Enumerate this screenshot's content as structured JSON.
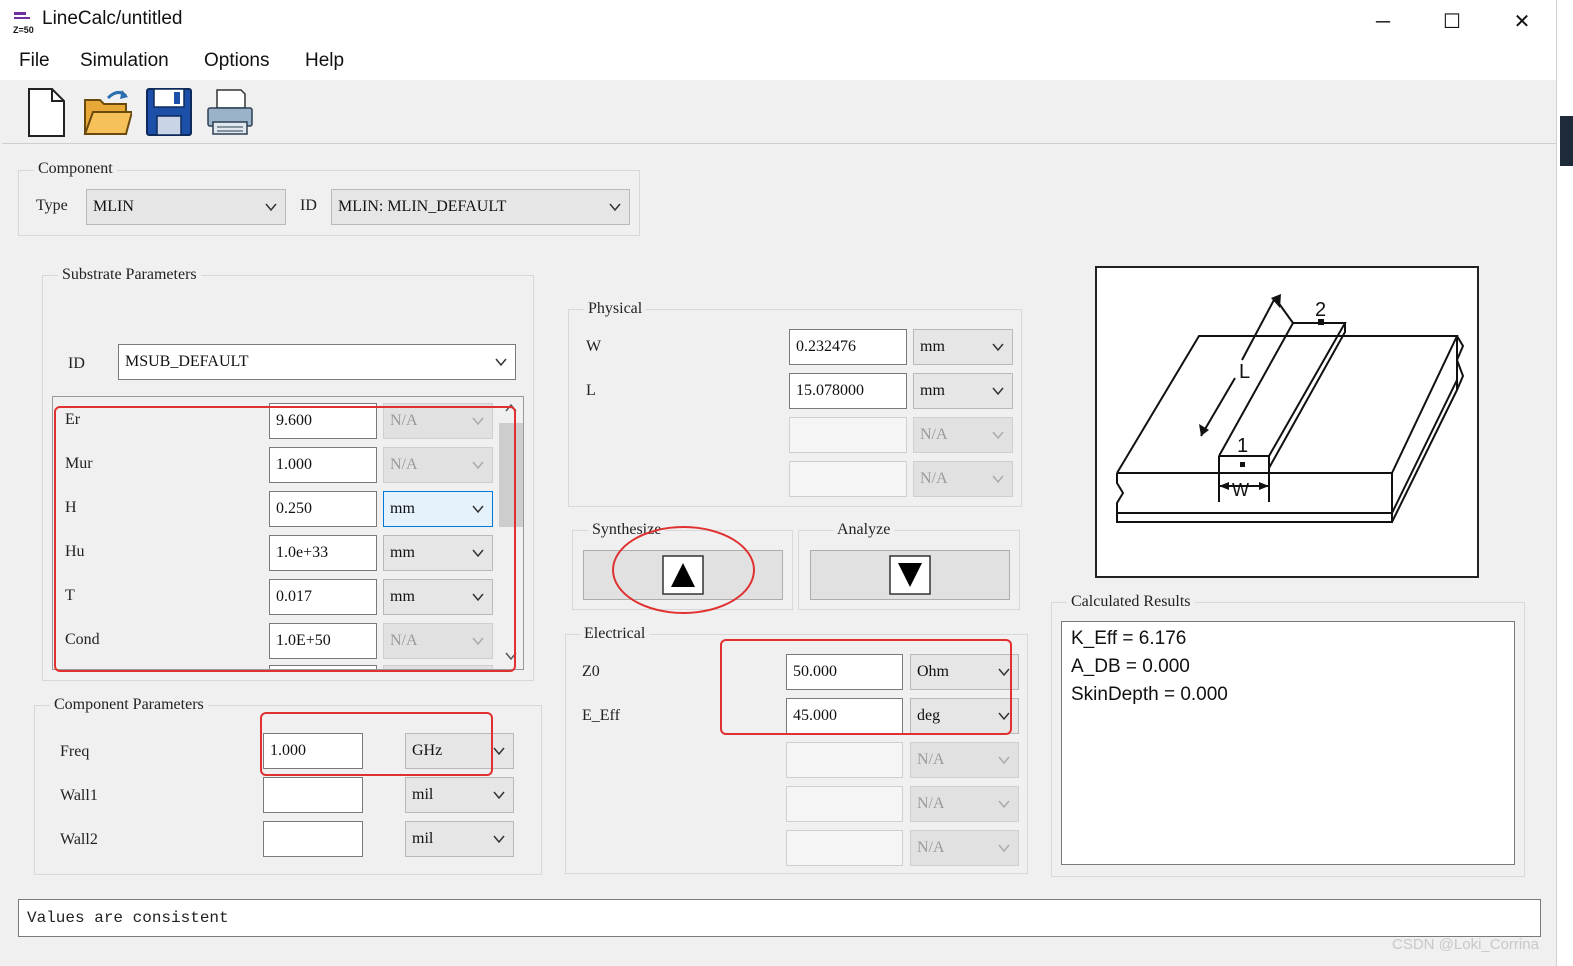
{
  "window": {
    "title": "LineCalc/untitled",
    "icon_label": "Z=50"
  },
  "menu": {
    "file": "File",
    "simulation": "Simulation",
    "options": "Options",
    "help": "Help"
  },
  "toolbar": {
    "new": "new-file-icon",
    "open": "open-folder-icon",
    "save": "save-disk-icon",
    "print": "printer-icon"
  },
  "component": {
    "title": "Component",
    "type_label": "Type",
    "type_value": "MLIN",
    "id_label": "ID",
    "id_value": "MLIN: MLIN_DEFAULT"
  },
  "substrate": {
    "title": "Substrate Parameters",
    "id_label": "ID",
    "id_value": "MSUB_DEFAULT",
    "rows": [
      {
        "label": "Er",
        "value": "9.600",
        "unit": "N/A",
        "unit_enabled": false
      },
      {
        "label": "Mur",
        "value": "1.000",
        "unit": "N/A",
        "unit_enabled": false
      },
      {
        "label": "H",
        "value": "0.250",
        "unit": "mm",
        "unit_enabled": true
      },
      {
        "label": "Hu",
        "value": "1.0e+33",
        "unit": "mm",
        "unit_enabled": true
      },
      {
        "label": "T",
        "value": "0.017",
        "unit": "mm",
        "unit_enabled": true
      },
      {
        "label": "Cond",
        "value": "1.0E+50",
        "unit": "N/A",
        "unit_enabled": false
      }
    ]
  },
  "component_params": {
    "title": "Component Parameters",
    "rows": [
      {
        "label": "Freq",
        "value": "1.000",
        "unit": "GHz"
      },
      {
        "label": "Wall1",
        "value": "",
        "unit": "mil"
      },
      {
        "label": "Wall2",
        "value": "",
        "unit": "mil"
      }
    ]
  },
  "physical": {
    "title": "Physical",
    "rows": [
      {
        "label": "W",
        "value": "0.232476",
        "unit": "mm",
        "enabled": true
      },
      {
        "label": "L",
        "value": "15.078000",
        "unit": "mm",
        "enabled": true
      },
      {
        "label": "",
        "value": "",
        "unit": "N/A",
        "enabled": false
      },
      {
        "label": "",
        "value": "",
        "unit": "N/A",
        "enabled": false
      }
    ]
  },
  "synthesize": {
    "title": "Synthesize"
  },
  "analyze": {
    "title": "Analyze"
  },
  "electrical": {
    "title": "Electrical",
    "rows": [
      {
        "label": "Z0",
        "value": "50.000",
        "unit": "Ohm",
        "enabled": true
      },
      {
        "label": "E_Eff",
        "value": "45.000",
        "unit": "deg",
        "enabled": true
      },
      {
        "label": "",
        "value": "",
        "unit": "N/A",
        "enabled": false
      },
      {
        "label": "",
        "value": "",
        "unit": "N/A",
        "enabled": false
      },
      {
        "label": "",
        "value": "",
        "unit": "N/A",
        "enabled": false
      }
    ]
  },
  "diagram": {
    "label_2": "2",
    "label_1": "1",
    "label_L": "L",
    "label_W": "W"
  },
  "results": {
    "title": "Calculated Results",
    "lines": [
      "K_Eff = 6.176",
      "A_DB = 0.000",
      "SkinDepth = 0.000"
    ]
  },
  "status": "Values are consistent",
  "watermark": "CSDN @Loki_Corrina",
  "colors": {
    "annotation": "#e03030",
    "focus": "#0078d7"
  }
}
